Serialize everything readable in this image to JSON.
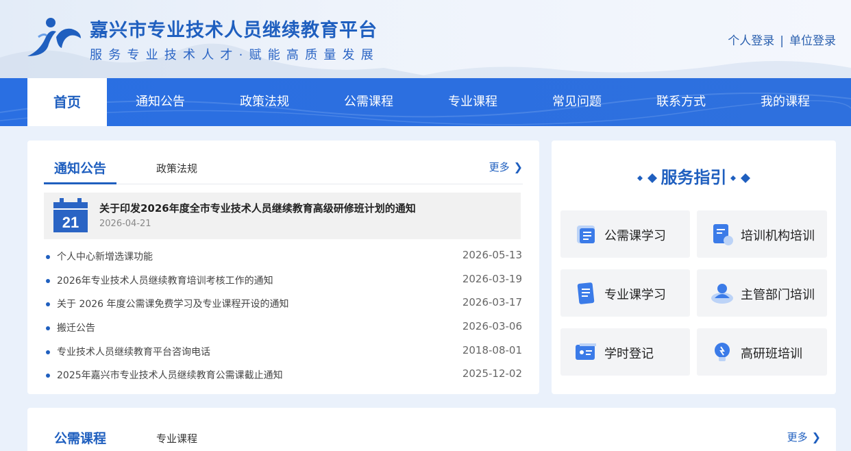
{
  "header": {
    "title": "嘉兴市专业技术人员继续教育平台",
    "slogan": "服务专业技术人才·赋能高质量发展",
    "login_personal": "个人登录",
    "login_sep": "|",
    "login_org": "单位登录"
  },
  "nav": {
    "items": [
      "首页",
      "通知公告",
      "政策法规",
      "公需课程",
      "专业课程",
      "常见问题",
      "联系方式",
      "我的课程"
    ],
    "active": "首页"
  },
  "news": {
    "tabs": [
      "通知公告",
      "政策法规"
    ],
    "more": "更多",
    "featured": {
      "day": "21",
      "title": "关于印发2026年度全市专业技术人员继续教育高级研修班计划的通知",
      "date": "2026-04-21"
    },
    "items": [
      {
        "title": "个人中心新增选课功能",
        "date": "2026-05-13"
      },
      {
        "title": "2026年专业技术人员继续教育培训考核工作的通知",
        "date": "2026-03-19"
      },
      {
        "title": "关于 2026 年度公需课免费学习及专业课程开设的通知",
        "date": "2026-03-17"
      },
      {
        "title": "搬迁公告",
        "date": "2026-03-06"
      },
      {
        "title": "专业技术人员继续教育平台咨询电话",
        "date": "2018-08-01"
      },
      {
        "title": "2025年嘉兴市专业技术人员继续教育公需课截止通知",
        "date": "2025-12-02"
      }
    ]
  },
  "services": {
    "heading": "服务指引",
    "buttons": [
      {
        "label": "公需课学习",
        "icon": "book-icon"
      },
      {
        "label": "培训机构培训",
        "icon": "document-icon"
      },
      {
        "label": "专业课学习",
        "icon": "notes-icon"
      },
      {
        "label": "主管部门培训",
        "icon": "user-icon"
      },
      {
        "label": "学时登记",
        "icon": "id-card-icon"
      },
      {
        "label": "高研班培训",
        "icon": "bulb-icon"
      }
    ]
  },
  "courses": {
    "tabs": [
      "公需课程",
      "专业课程"
    ],
    "more": "更多"
  },
  "colors": {
    "brand": "#1f5fbf",
    "nav": "#2c6fe0",
    "bg": "#eaf1fb"
  }
}
